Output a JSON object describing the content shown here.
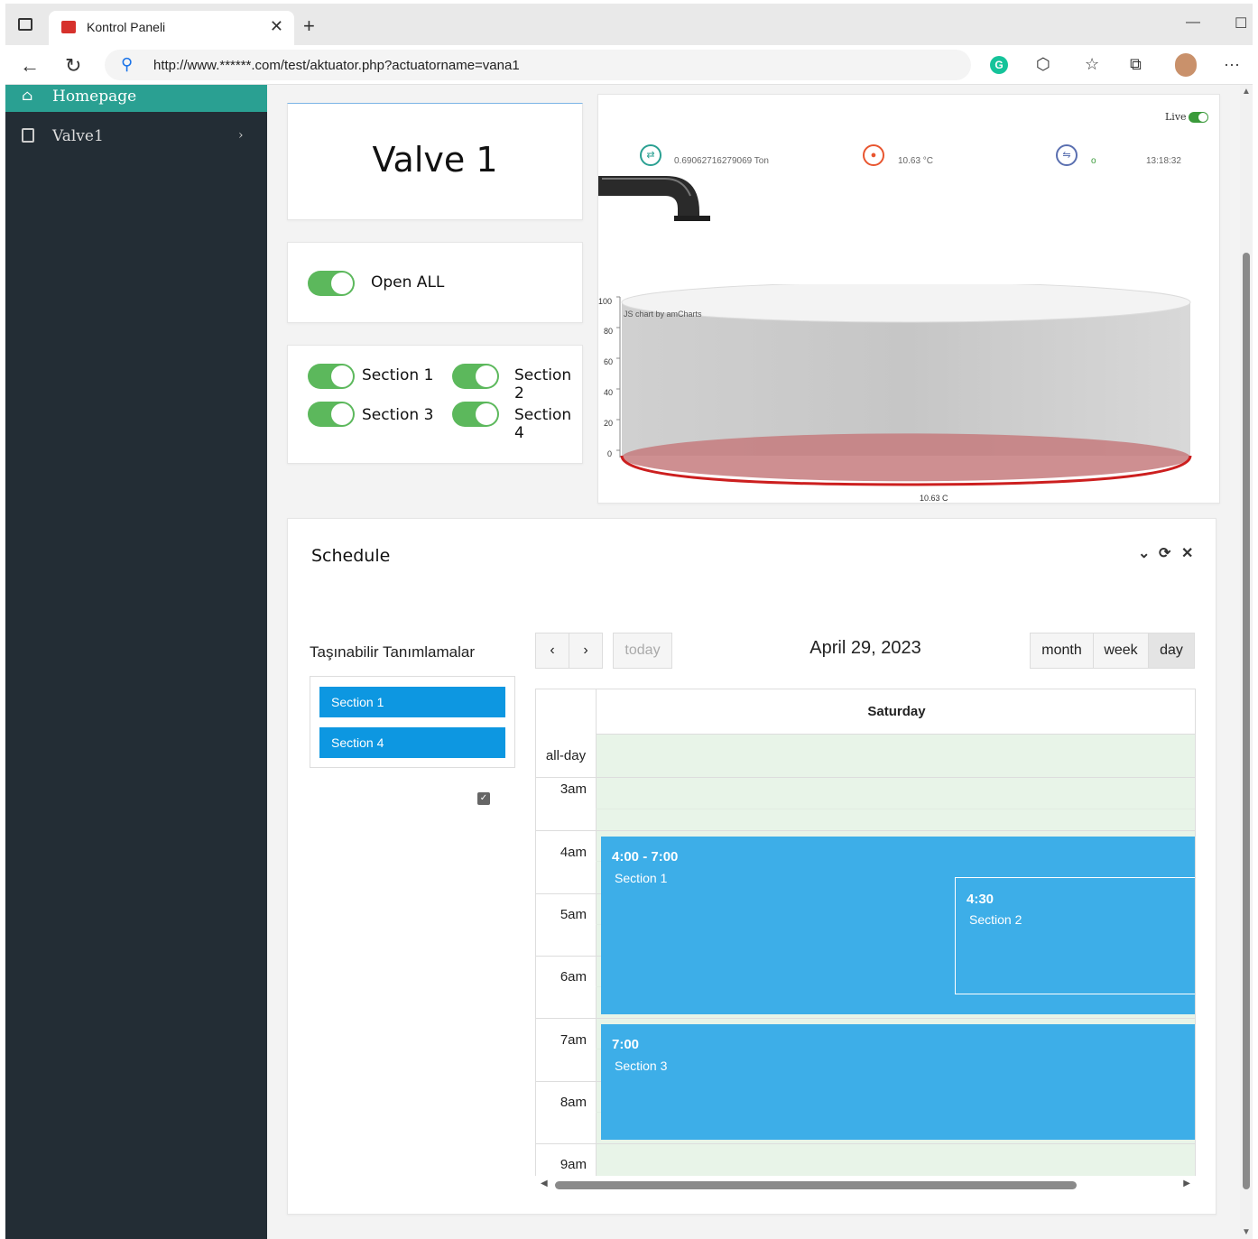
{
  "browser": {
    "tab_title": "Kontrol Paneli",
    "url": "http://www.******.com/test/aktuator.php?actuatorname=vana1"
  },
  "sidebar": {
    "items": [
      {
        "label": "Homepage",
        "icon": "home-icon",
        "active": true
      },
      {
        "label": "Valve1",
        "icon": "copy-icon",
        "active": false
      }
    ]
  },
  "valve": {
    "title": "Valve 1"
  },
  "open_all": {
    "label": "Open ALL",
    "on": true
  },
  "sections": [
    {
      "label": "Section 1",
      "on": true
    },
    {
      "label": "Section 2",
      "on": true
    },
    {
      "label": "Section 3",
      "on": true
    },
    {
      "label": "Section 4",
      "on": true
    }
  ],
  "monitor": {
    "live_label": "Live",
    "live_on": true,
    "flow_value": "0.69062716279069 Ton",
    "temp_value": "10.63 °C",
    "status_value": "o",
    "time": "13:18:32",
    "tank_credit": "JS chart by amCharts",
    "tank_label": "10.63 C",
    "colors": {
      "water": "#c67b7e",
      "flow_icon": "#2aa092",
      "temp_icon": "#e8552f",
      "status_icon": "#5a6fb0"
    }
  },
  "chart_data": {
    "type": "cylinder-gauge",
    "y_ticks": [
      "100",
      "80",
      "60",
      "40",
      "20",
      "0"
    ],
    "ylim": [
      0,
      100
    ],
    "value": 10.63,
    "label": "10.63 C"
  },
  "schedule": {
    "title": "Schedule",
    "external_title": "Taşınabilir Tanımlamalar",
    "external_events": [
      "Section 1",
      "Section 4"
    ],
    "today_label": "today",
    "date_title": "April 29, 2023",
    "views": [
      "month",
      "week",
      "day"
    ],
    "active_view": "day",
    "day_header": "Saturday",
    "allday_label": "all-day",
    "hours": [
      "3am",
      "4am",
      "5am",
      "6am",
      "7am",
      "8am",
      "9am"
    ],
    "events": [
      {
        "time": "4:00 - 7:00",
        "name": "Section 1"
      },
      {
        "time": "4:30",
        "name": "Section 2"
      },
      {
        "time": "7:00",
        "name": "Section  3"
      }
    ]
  }
}
